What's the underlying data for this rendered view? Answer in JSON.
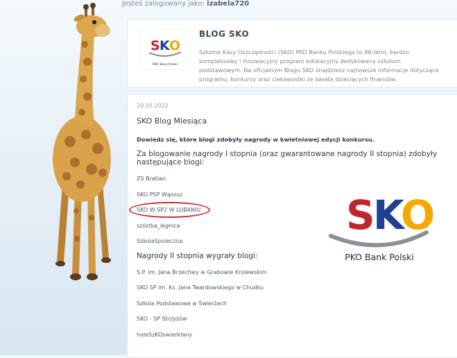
{
  "login": {
    "prefix": "Jesteś zalogowany jako:",
    "username": "izabela720"
  },
  "blog": {
    "title": "BLOG SKO",
    "description": "Szkolne Kasy Oszczędności (SKO) PKO Banku Polskiego to 86-letni, bardzo kompleksowy i innowacyjny program edukacyjny dedykowany szkołom podstawowym. Na oficjalnym Blogu SKO znajdziesz najnowsze informacje dotyczące programu, konkursy oraz ciekawostki ze świata dziecięcych finansów.",
    "logo_text": "SKO",
    "logo_caption": "PKO Bank Polski"
  },
  "post": {
    "date": "20.05.2022",
    "title": "SKO Blog Miesiąca",
    "intro": "Dowiedz się, które blogi zdobyły nagrody w kwietniowej edycji konkursu.",
    "first_heading": "Za blogowanie nagrody I stopnia (oraz gwarantowane nagrody II stopnia) zdobyły następujące blogi:",
    "first_list": [
      "ZS Bratian",
      "SKO PSP Wąsosz",
      "SKO W SP2 W LUBANIU",
      "szóstka_legnica",
      "SzkolaSpoleczna"
    ],
    "second_heading": "Nagrody II stopnia wygrały blogi:",
    "second_list": [
      "S.P. im. Jana Brzechwy w Grabowie Krolewskim",
      "SKO SP im. Ks. Jana Twardowskiego w Chudku",
      "Szkola Podstawowa w Świerżach",
      "SKO - SP Strzyżów",
      "hole5zKOswierklany"
    ],
    "logo_text": "SKO",
    "logo_caption": "PKO Bank Polski"
  },
  "colors": {
    "highlight": "#d9242b",
    "s": "#c0262e",
    "k": "#1f3f8f",
    "o": "#f2a900"
  }
}
